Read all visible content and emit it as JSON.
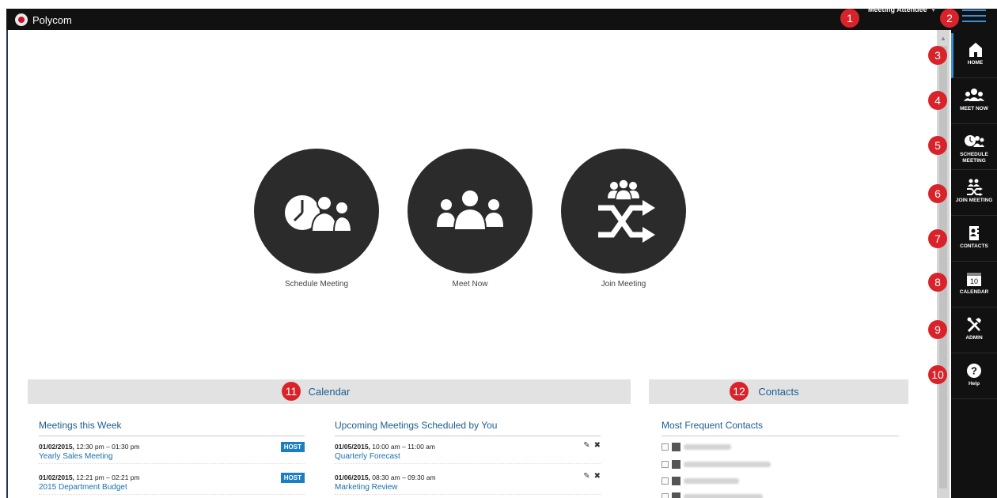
{
  "app": {
    "brand": "Polycom"
  },
  "header": {
    "user_menu": "Meeting Attendee"
  },
  "sidebar": {
    "items": [
      {
        "label": "HOME",
        "icon": "home-icon"
      },
      {
        "label": "MEET NOW",
        "icon": "group-icon"
      },
      {
        "label": "SCHEDULE MEETING",
        "icon": "clock-group-icon"
      },
      {
        "label": "JOIN MEETING",
        "icon": "join-icon"
      },
      {
        "label": "CONTACTS",
        "icon": "contacts-icon"
      },
      {
        "label": "CALENDAR",
        "icon": "calendar-icon",
        "day": "10"
      },
      {
        "label": "ADMIN",
        "icon": "tools-icon"
      },
      {
        "label": "Help",
        "icon": "help-icon"
      }
    ]
  },
  "hero": [
    {
      "label": "Schedule Meeting",
      "icon": "schedule-meeting-icon"
    },
    {
      "label": "Meet Now",
      "icon": "meet-now-icon"
    },
    {
      "label": "Join Meeting",
      "icon": "join-meeting-icon"
    }
  ],
  "calendar": {
    "title": "Calendar",
    "week_header": "Meetings this Week",
    "upcoming_header": "Upcoming Meetings Scheduled by You",
    "week": [
      {
        "date": "01/02/2015,",
        "time": " 12:30 pm – 01:30 pm",
        "title": "Yearly Sales Meeting",
        "badge": "HOST"
      },
      {
        "date": "01/02/2015,",
        "time": " 12:21 pm – 02:21 pm",
        "title": "2015 Department Budget",
        "badge": "HOST"
      }
    ],
    "upcoming": [
      {
        "date": "01/05/2015,",
        "time": " 10:00 am – 11:00 am",
        "title": "Quarterly Forecast"
      },
      {
        "date": "01/06/2015,",
        "time": " 08:30 am – 09:30 am",
        "title": "Marketing Review"
      }
    ]
  },
  "contacts": {
    "title": "Contacts",
    "frequent_header": "Most Frequent Contacts"
  },
  "callouts": [
    "1",
    "2",
    "3",
    "4",
    "5",
    "6",
    "7",
    "8",
    "9",
    "10",
    "11",
    "12"
  ],
  "colors": {
    "accent": "#1b5e93",
    "callout": "#d9232b",
    "topbar": "#111111"
  }
}
